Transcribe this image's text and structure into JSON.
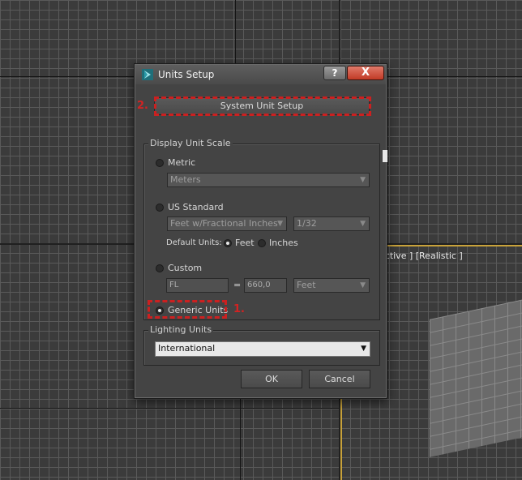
{
  "viewport": {
    "label": "ective ] [Realistic ]"
  },
  "dialog": {
    "title": "Units Setup",
    "help_glyph": "?",
    "close_glyph": "X",
    "system_unit_setup_label": "System Unit Setup",
    "display_unit_scale": {
      "group_label": "Display Unit Scale",
      "metric": {
        "label": "Metric",
        "selected": false,
        "dropdown_value": "Meters"
      },
      "us_standard": {
        "label": "US Standard",
        "selected": false,
        "unit_dropdown_value": "Feet w/Fractional Inches",
        "fraction_dropdown_value": "1/32",
        "default_units_label": "Default Units:",
        "feet_label": "Feet",
        "inches_label": "Inches",
        "default_unit_selected": "Feet"
      },
      "custom": {
        "label": "Custom",
        "selected": false,
        "name_value": "FL",
        "equals": "=",
        "amount_value": "660,0",
        "unit_dropdown_value": "Feet"
      },
      "generic": {
        "label": "Generic Units",
        "selected": true
      }
    },
    "lighting_units": {
      "group_label": "Lighting Units",
      "dropdown_value": "International"
    },
    "ok_label": "OK",
    "cancel_label": "Cancel"
  },
  "annotations": {
    "step1": "1.",
    "step2": "2."
  },
  "colors": {
    "annotation_red": "#cc2020",
    "viewport_highlight": "#c8a23a",
    "close_button": "#c13a26"
  }
}
